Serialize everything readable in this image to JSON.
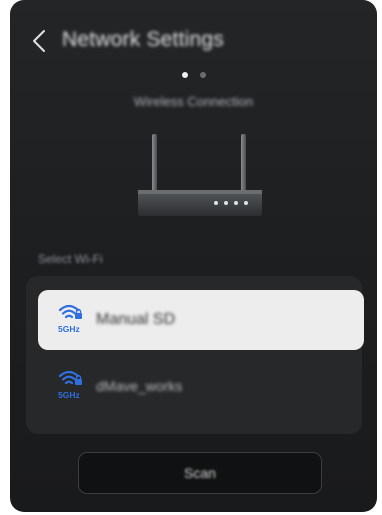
{
  "header": {
    "title": "Network Settings"
  },
  "pager": {
    "total": 2,
    "active": 0
  },
  "subtitle": "Wireless Connection",
  "section_label": "Select Wi-Fi",
  "wifi_list": [
    {
      "name": "Manual SD",
      "band": "5GHz",
      "selected": true
    },
    {
      "name": "dMave_works",
      "band": "5GHz",
      "selected": false
    }
  ],
  "scan_button": {
    "label": "Scan"
  },
  "colors": {
    "accent_blue": "#2f6fe0",
    "panel_bg": "#1f2123",
    "selected_row": "#ededed"
  }
}
